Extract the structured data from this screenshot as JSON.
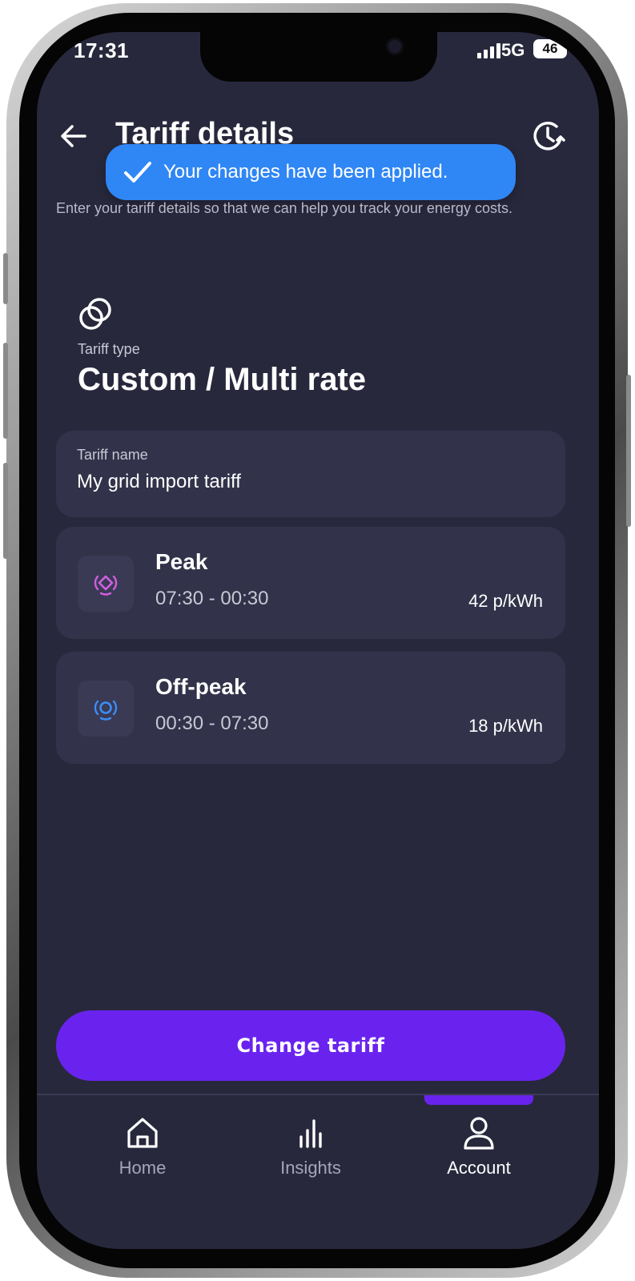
{
  "status_bar": {
    "time": "17:31",
    "network": "5G",
    "battery": "46"
  },
  "header": {
    "title": "Tariff details",
    "back_icon": "arrow-left-icon",
    "history_icon": "clock-history-icon"
  },
  "toast": {
    "message": "Your changes have been applied.",
    "icon": "check-icon",
    "color": "#2f86f5"
  },
  "intro_text": "Enter your tariff details so that we can help you track your energy costs.",
  "tariff_type": {
    "icon": "linked-circles-icon",
    "label": "Tariff type",
    "value": "Custom / Multi rate"
  },
  "tariff_name": {
    "label": "Tariff name",
    "value": "My grid import tariff"
  },
  "rates": [
    {
      "name": "Peak",
      "time": "07:30 - 00:30",
      "price": "42 p/kWh",
      "icon": "peak-signal-icon",
      "color": "#d15fe0"
    },
    {
      "name": "Off-peak",
      "time": "00:30 - 07:30",
      "price": "18 p/kWh",
      "icon": "offpeak-signal-icon",
      "color": "#3b8df7"
    }
  ],
  "cta": {
    "label": "Change tariff",
    "color": "#6a23ef"
  },
  "nav": {
    "items": [
      {
        "label": "Home",
        "icon": "home-icon",
        "active": false
      },
      {
        "label": "Insights",
        "icon": "bar-chart-icon",
        "active": false
      },
      {
        "label": "Account",
        "icon": "person-icon",
        "active": true
      }
    ]
  },
  "colors": {
    "background": "#28283d",
    "card": "#32324a",
    "accent": "#6a23ef"
  }
}
